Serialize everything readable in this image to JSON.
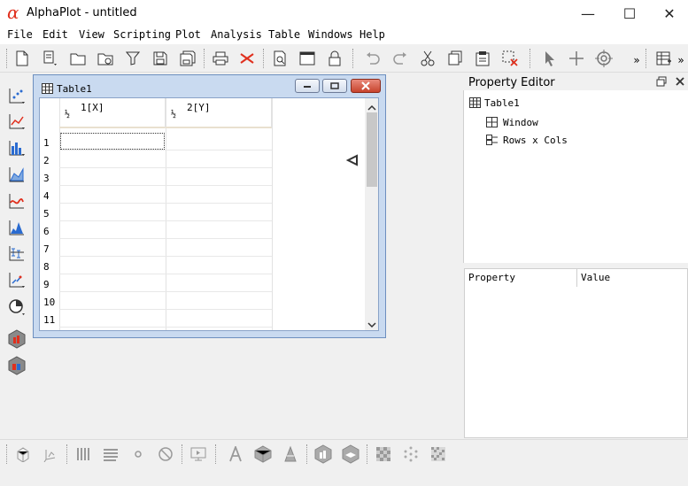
{
  "app": {
    "logo_glyph": "α",
    "title": "AlphaPlot - untitled",
    "window_buttons": {
      "minimize": "—",
      "maximize": "☐",
      "close": "✕"
    }
  },
  "menu": [
    "File",
    "Edit",
    "View",
    "Scripting",
    "Plot",
    "Analysis",
    "Table",
    "Windows",
    "Help"
  ],
  "toolbar": {
    "overflow_1": "»",
    "overflow_2": "»"
  },
  "table_window": {
    "title": "Table1",
    "columns": [
      {
        "name": "1[X]",
        "fraction": "½"
      },
      {
        "name": "2[Y]",
        "fraction": "½"
      }
    ],
    "rows": [
      "1",
      "2",
      "3",
      "4",
      "5",
      "6",
      "7",
      "8",
      "9",
      "10",
      "11"
    ]
  },
  "property_editor": {
    "title": "Property Editor",
    "tree": {
      "root": "Table1",
      "children": [
        "Window",
        "Rows x Cols"
      ]
    },
    "columns": {
      "property": "Property",
      "value": "Value"
    }
  },
  "colors": {
    "accent_red": "#e0301e",
    "window_frame": "#c9daf0",
    "close_button": "#d9452e"
  }
}
